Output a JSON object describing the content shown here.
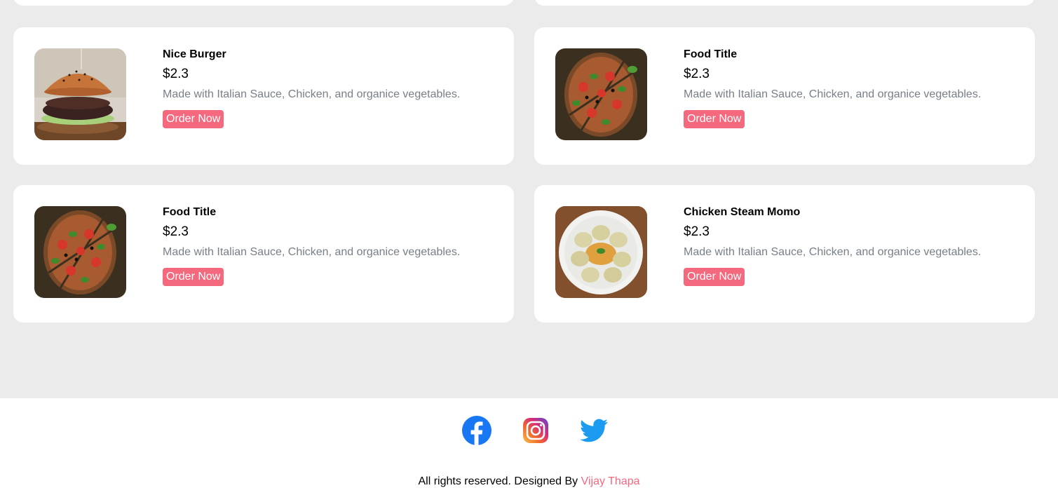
{
  "food_items": [
    {
      "image": "burger-photo",
      "title": "Nice Burger",
      "price": "$2.3",
      "description": "Made with Italian Sauce, Chicken, and organice vegetables.",
      "order_label": "Order Now"
    },
    {
      "image": "pizza-photo",
      "title": "Food Title",
      "price": "$2.3",
      "description": "Made with Italian Sauce, Chicken, and organice vegetables.",
      "order_label": "Order Now"
    },
    {
      "image": "pizza-photo",
      "title": "Food Title",
      "price": "$2.3",
      "description": "Made with Italian Sauce, Chicken, and organice vegetables.",
      "order_label": "Order Now"
    },
    {
      "image": "momo-photo",
      "title": "Chicken Steam Momo",
      "price": "$2.3",
      "description": "Made with Italian Sauce, Chicken, and organice vegetables.",
      "order_label": "Order Now"
    }
  ],
  "footer": {
    "social_icons": [
      "facebook-icon",
      "instagram-icon",
      "twitter-icon"
    ],
    "copyright_text": "All rights reserved. Designed By ",
    "designer_name": "Vijay Thapa"
  },
  "colors": {
    "accent": "#f5697f",
    "page_background": "#ebebeb",
    "card_background": "#ffffff",
    "description_text": "#777f87"
  }
}
